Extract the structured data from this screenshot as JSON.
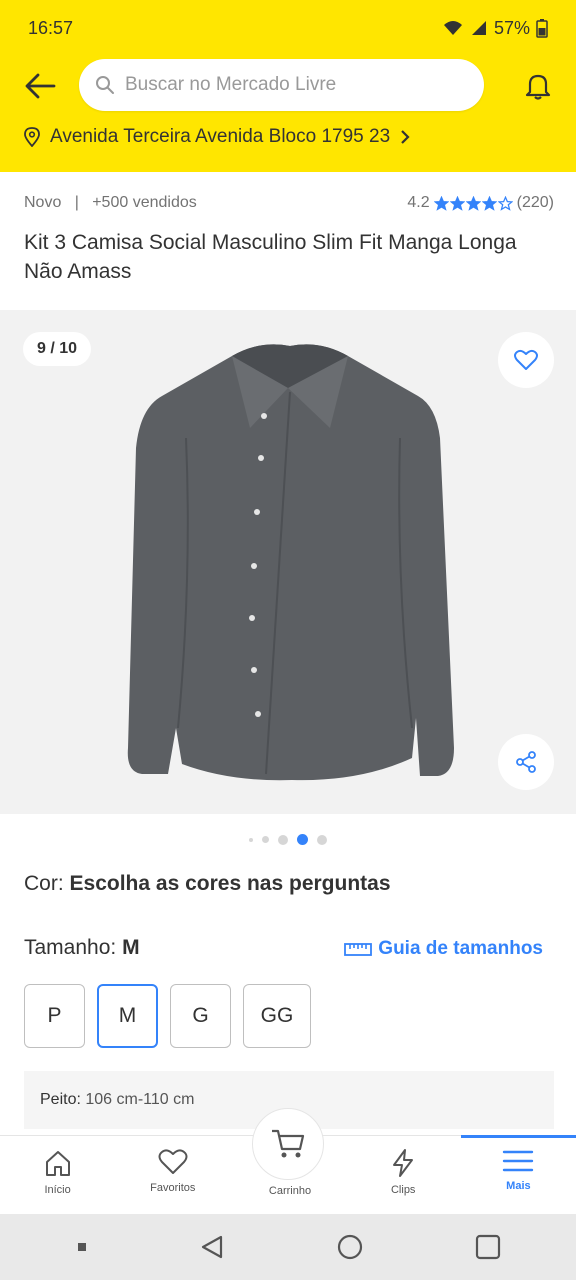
{
  "status_bar": {
    "time": "16:57",
    "battery": "57%"
  },
  "header": {
    "search_placeholder": "Buscar no Mercado Livre",
    "address": "Avenida Terceira Avenida Bloco 1795 23"
  },
  "product": {
    "condition": "Novo",
    "sold": "+500 vendidos",
    "rating": "4.2",
    "reviews": "(220)",
    "stars_filled": 4,
    "title": "Kit 3 Camisa Social Masculino Slim Fit Manga Longa Não Amass"
  },
  "gallery": {
    "counter": "9 / 10",
    "current_index": 9,
    "total": 10
  },
  "variations": {
    "color_label": "Cor:",
    "color_value": "Escolha as cores nas perguntas",
    "size_label": "Tamanho:",
    "size_value": "M",
    "size_guide": "Guia de tamanhos",
    "sizes": [
      "P",
      "M",
      "G",
      "GG"
    ],
    "selected_size": "M",
    "measure_label": "Peito:",
    "measure_value": "106 cm-110 cm"
  },
  "bottom_nav": {
    "items": [
      "Início",
      "Favoritos",
      "Carrinho",
      "Clips",
      "Mais"
    ],
    "active": "Mais"
  },
  "colors": {
    "brand_yellow": "#ffe600",
    "accent_blue": "#3483fa"
  }
}
